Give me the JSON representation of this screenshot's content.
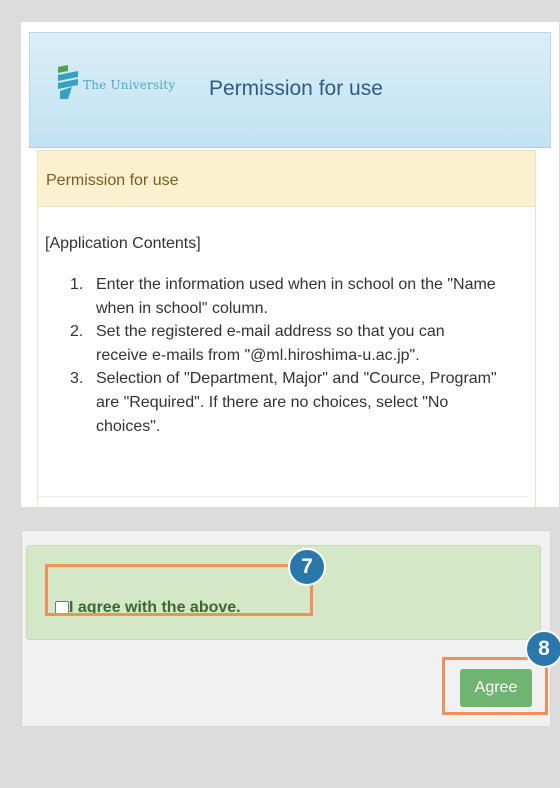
{
  "header": {
    "logo_text": "The University",
    "page_title": "Permission for use",
    "logo_icon": "university-logo-icon"
  },
  "notice": {
    "title": "Permission for use",
    "section_label": "[Application Contents]",
    "steps": [
      {
        "num": "1.",
        "text": "Enter the information used when in school on the \"Name when in school\" column."
      },
      {
        "num": "2.",
        "text": "Set the registered e-mail address so that you can receive e-mails from \"@ml.hiroshima-u.ac.jp\"."
      },
      {
        "num": "3.",
        "text": "Selection of \"Department, Major\" and \"Cource, Program\" are \"Required\". If there are no choices, select \"No choices\"."
      }
    ]
  },
  "agreement": {
    "checkbox_label": "I agree with the above.",
    "checked": false,
    "button_label": "Agree"
  },
  "callouts": {
    "step7": "7",
    "step8": "8"
  },
  "colors": {
    "callout_badge": "#2a78aa",
    "callout_border": "#f0915d",
    "agree_button": "#6fb46f",
    "header_title": "#2f5b84"
  }
}
